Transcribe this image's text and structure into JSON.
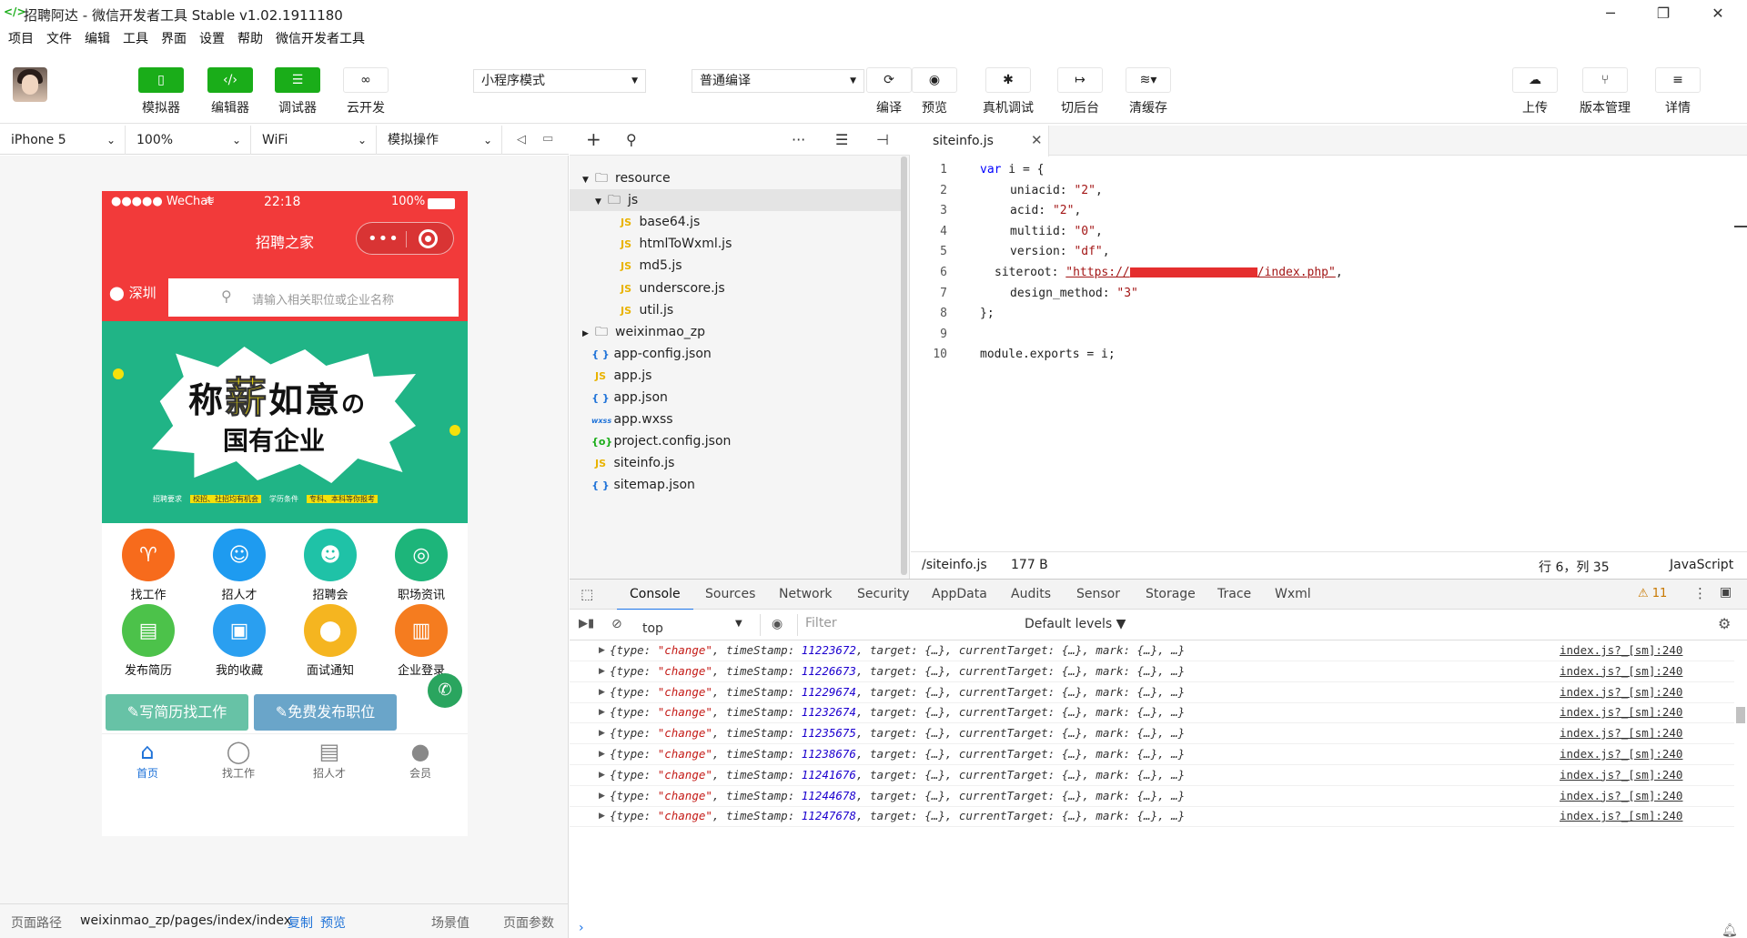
{
  "window": {
    "title": "招聘阿达 - 微信开发者工具 Stable v1.02.1911180",
    "minimize": "─",
    "maximize": "❐",
    "close": "✕"
  },
  "menu": [
    "项目",
    "文件",
    "编辑",
    "工具",
    "界面",
    "设置",
    "帮助",
    "微信开发者工具"
  ],
  "toolbar": {
    "simulator": "模拟器",
    "editor": "编辑器",
    "debugger": "调试器",
    "cloud": "云开发",
    "mode_select": "小程序模式",
    "compile_select": "普通编译",
    "compile": "编译",
    "preview": "预览",
    "remote_debug": "真机调试",
    "background": "切后台",
    "clear_cache": "清缓存",
    "upload": "上传",
    "version": "版本管理",
    "details": "详情"
  },
  "devicebar": {
    "device": "iPhone 5",
    "zoom": "100%",
    "network": "WiFi",
    "operation": "模拟操作"
  },
  "phone": {
    "carrier": "●●●●● WeChat",
    "time": "22:18",
    "battery": "100%",
    "nav_title": "招聘之家",
    "city": "深圳",
    "search_placeholder": "请输入相关职位或企业名称",
    "banner_title_a": "称",
    "banner_title_hl": "薪",
    "banner_title_b": "如意",
    "banner_title_c": "の",
    "banner_sub": "国有企业",
    "banner_foot1": "招聘要求",
    "banner_foot2": "校招、社招均有机会",
    "banner_foot3": "学历条件",
    "banner_foot4": "专科、本科等你报考",
    "grid": [
      {
        "label": "找工作",
        "icon": "tie-icon",
        "color": "#f76b1c"
      },
      {
        "label": "招人才",
        "icon": "person-icon",
        "color": "#1e9bf0"
      },
      {
        "label": "招聘会",
        "icon": "group-icon",
        "color": "#1fc2a7"
      },
      {
        "label": "职场资讯",
        "icon": "broadcast-icon",
        "color": "#1db57a"
      },
      {
        "label": "发布简历",
        "icon": "resume-icon",
        "color": "#4cc24a"
      },
      {
        "label": "我的收藏",
        "icon": "briefcase-icon",
        "color": "#2a9ff0"
      },
      {
        "label": "面试通知",
        "icon": "location-icon",
        "color": "#f5b520"
      },
      {
        "label": "企业登录",
        "icon": "building-icon",
        "color": "#f57c1f"
      }
    ],
    "btn_resume": "✎写简历找工作",
    "btn_post": "✎免费发布职位",
    "tabs": [
      {
        "label": "首页",
        "icon": "⌂"
      },
      {
        "label": "找工作",
        "icon": "◯"
      },
      {
        "label": "招人才",
        "icon": "▤"
      },
      {
        "label": "会员",
        "icon": "●"
      }
    ]
  },
  "simstatus": {
    "path_label": "页面路径",
    "path": "weixinmao_zp/pages/index/index",
    "copy": "复制",
    "preview": "预览",
    "scene": "场景值",
    "params": "页面参数"
  },
  "tree": [
    {
      "name": "resource",
      "type": "folder",
      "indent": 0,
      "open": true
    },
    {
      "name": "js",
      "type": "folder",
      "indent": 1,
      "open": true,
      "selected": true
    },
    {
      "name": "base64.js",
      "type": "js",
      "indent": 2
    },
    {
      "name": "htmlToWxml.js",
      "type": "js",
      "indent": 2
    },
    {
      "name": "md5.js",
      "type": "js",
      "indent": 2
    },
    {
      "name": "underscore.js",
      "type": "js",
      "indent": 2
    },
    {
      "name": "util.js",
      "type": "js",
      "indent": 2
    },
    {
      "name": "weixinmao_zp",
      "type": "folder",
      "indent": 0,
      "open": false
    },
    {
      "name": "app-config.json",
      "type": "json",
      "indent": 0
    },
    {
      "name": "app.js",
      "type": "js",
      "indent": 0
    },
    {
      "name": "app.json",
      "type": "json",
      "indent": 0
    },
    {
      "name": "app.wxss",
      "type": "wxss",
      "indent": 0
    },
    {
      "name": "project.config.json",
      "type": "cfg",
      "indent": 0
    },
    {
      "name": "siteinfo.js",
      "type": "js",
      "indent": 0
    },
    {
      "name": "sitemap.json",
      "type": "json",
      "indent": 0
    }
  ],
  "editor": {
    "tab": "siteinfo.js",
    "lines": [
      "1",
      "2",
      "3",
      "4",
      "5",
      "6",
      "7",
      "8",
      "9",
      "10"
    ],
    "status_path": "/siteinfo.js",
    "status_size": "177 B",
    "status_pos": "行 6，列 35",
    "status_lang": "JavaScript",
    "code": {
      "l1a": "var",
      "l1b": " i = {",
      "l2a": "uniacid: ",
      "l2b": "\"2\"",
      "l2c": ",",
      "l3a": "acid: ",
      "l3b": "\"2\"",
      "l3c": ",",
      "l4a": "multiid: ",
      "l4b": "\"0\"",
      "l4c": ",",
      "l5a": "version: ",
      "l5b": "\"df\"",
      "l5c": ",",
      "l6a": "siteroot: ",
      "l6b": "\"https://",
      "l6c": "/index.php\"",
      "l6d": ",",
      "l7a": "design_method: ",
      "l7b": "\"3\"",
      "l8": "};",
      "l10": "module.exports = i;"
    }
  },
  "console": {
    "tabs": [
      "Console",
      "Sources",
      "Network",
      "Security",
      "AppData",
      "Audits",
      "Sensor",
      "Storage",
      "Trace",
      "Wxml"
    ],
    "warn_count": "⚠ 11",
    "context": "top",
    "filter_placeholder": "Filter",
    "levels": "Default levels ▼",
    "logs": [
      {
        "ts": "11223672"
      },
      {
        "ts": "11226673"
      },
      {
        "ts": "11229674"
      },
      {
        "ts": "11232674"
      },
      {
        "ts": "11235675"
      },
      {
        "ts": "11238676"
      },
      {
        "ts": "11241676"
      },
      {
        "ts": "11244678"
      },
      {
        "ts": "11247678"
      }
    ],
    "log_prefix": "{type: ",
    "log_type": "\"change\"",
    "log_mid": ", timeStamp: ",
    "log_suffix": ", target: {…}, currentTarget: {…}, mark: {…}, …}",
    "log_source": "index.js?_[sm]:240",
    "prompt": "›"
  }
}
